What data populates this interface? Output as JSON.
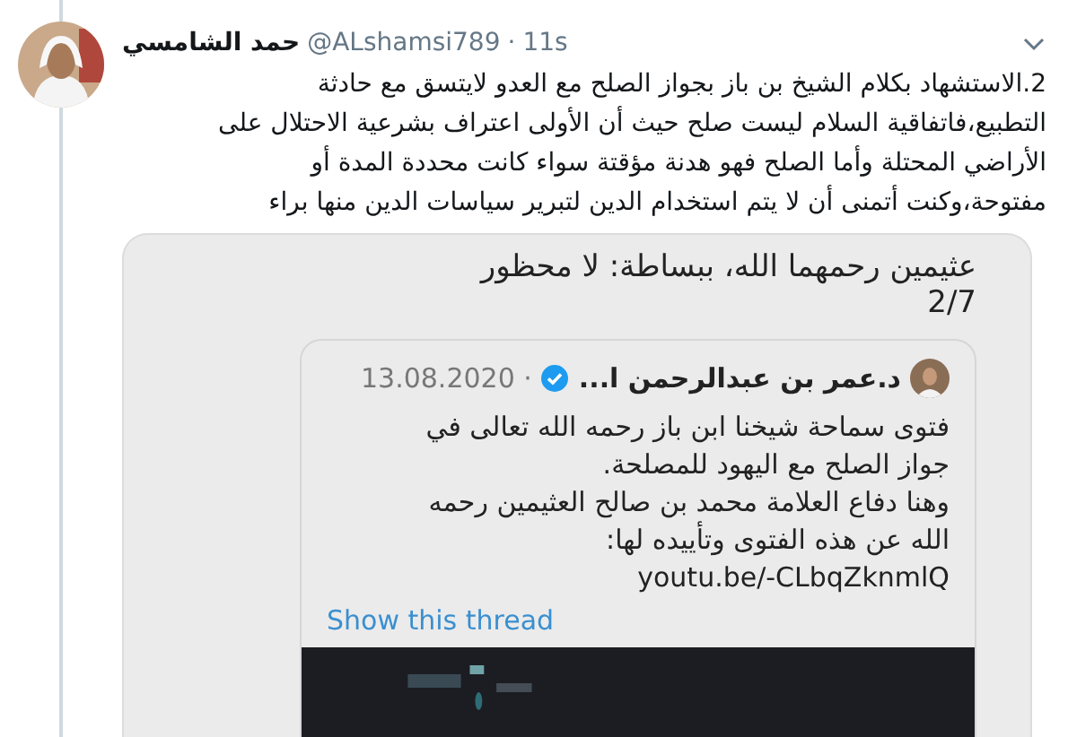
{
  "tweet": {
    "author": "حمد الشامسي",
    "handle": "@ALshamsi789",
    "separator": "·",
    "time": "11s",
    "lines": [
      "2.الاستشهاد بكلام الشيخ بن باز بجواز الصلح مع العدو لايتسق مع حادثة",
      "التطبيع،فاتفاقية السلام ليست صلح حيث أن الأولى اعتراف بشرعية الاحتلال على",
      "الأراضي المحتلة وأما الصلح فهو هدنة مؤقتة سواء كانت محددة المدة أو",
      "مفتوحة،وكنت أتمنى أن لا يتم استخدام الدين لتبرير سياسات الدين منها براء"
    ]
  },
  "attached_screenshot": {
    "lines": [
      "عثيمين رحمهما الله، ببساطة: لا محظور",
      "2/7"
    ],
    "quoted_tweet": {
      "author": "د.عمر بن عبدالرحمن ا...",
      "verified": true,
      "date": "· 13.08.2020",
      "lines": [
        "فتوى سماحة شيخنا ابن باز رحمه الله تعالى في",
        "جواز الصلح مع اليهود للمصلحة.",
        "وهنا دفاع العلامة محمد بن صالح العثيمين رحمه",
        "الله  عن هذه الفتوى وتأييده لها:",
        "youtu.be/-CLbqZknmlQ"
      ]
    },
    "show_thread": "Show this thread"
  }
}
